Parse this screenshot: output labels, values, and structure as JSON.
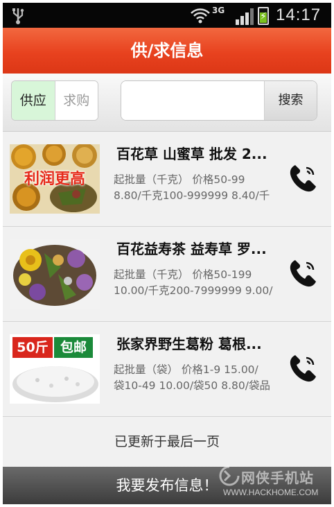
{
  "status_bar": {
    "network": "3G",
    "time": "14:17"
  },
  "header": {
    "title": "供/求信息"
  },
  "filter": {
    "tabs": [
      {
        "label": "供应",
        "selected": true
      },
      {
        "label": "求购",
        "selected": false
      }
    ],
    "search": {
      "value": "",
      "placeholder": "",
      "button_label": "搜索"
    }
  },
  "items": [
    {
      "title": "百花草 山蜜草 批发 2...",
      "line1": "起批量（千克） 价格50-99",
      "line2": "8.80/千克100-999999 8.40/千",
      "thumb_caption": "利润更高",
      "icon": "phone-icon"
    },
    {
      "title": "百花益寿茶 益寿草 罗...",
      "line1": "起批量（千克） 价格50-199",
      "line2": "10.00/千克200-7999999 9.00/",
      "icon": "phone-icon"
    },
    {
      "title": "张家界野生葛粉 葛根...",
      "line1": "起批量（袋） 价格1-9 15.00/",
      "line2": "袋10-49 10.00/袋50 8.80/袋品",
      "thumb_badge_left": "50斤",
      "thumb_badge_right": "包邮",
      "icon": "phone-icon"
    }
  ],
  "list_end_text": "已更新于最后一页",
  "bottom_button": {
    "label": "我要发布信息！"
  },
  "watermark": {
    "text": "网侠手机站",
    "url": "WWW.HACKHOME.COM"
  },
  "colors": {
    "title_bar": "#e8421f",
    "selected_tab": "#d8f6d9",
    "status_bar": "#060606",
    "bottom_bar": "#4a4a4a"
  }
}
